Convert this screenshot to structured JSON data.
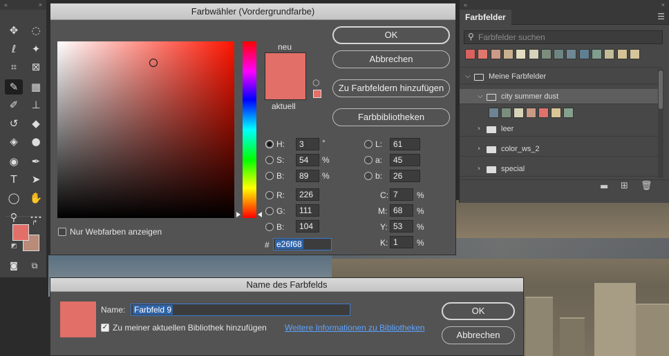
{
  "toolbar": {
    "collapse": "«",
    "close": "×",
    "tools": [
      {
        "name": "move",
        "glyph": "✥"
      },
      {
        "name": "marquee",
        "glyph": "◌"
      },
      {
        "name": "lasso",
        "glyph": "ℓ"
      },
      {
        "name": "magic-wand",
        "glyph": "✦"
      },
      {
        "name": "crop",
        "glyph": "⌗"
      },
      {
        "name": "frame",
        "glyph": "⊠"
      },
      {
        "name": "eyedropper",
        "glyph": "✎"
      },
      {
        "name": "spot-healing",
        "glyph": "▦"
      },
      {
        "name": "brush",
        "glyph": "✐"
      },
      {
        "name": "clone-stamp",
        "glyph": "⊥"
      },
      {
        "name": "history-brush",
        "glyph": "↺"
      },
      {
        "name": "eraser",
        "glyph": "◆"
      },
      {
        "name": "paint-bucket",
        "glyph": "◈"
      },
      {
        "name": "blur",
        "glyph": "●"
      },
      {
        "name": "dodge",
        "glyph": "◉"
      },
      {
        "name": "pen",
        "glyph": "✒"
      },
      {
        "name": "type",
        "glyph": "T"
      },
      {
        "name": "path-select",
        "glyph": "➤"
      },
      {
        "name": "ellipse",
        "glyph": "◯"
      },
      {
        "name": "hand",
        "glyph": "✋"
      },
      {
        "name": "zoom",
        "glyph": "⚲"
      },
      {
        "name": "more",
        "glyph": "•••"
      }
    ],
    "foreground_color": "#e26f68",
    "background_color": "#b98b78"
  },
  "color_picker": {
    "title": "Farbwähler (Vordergrundfarbe)",
    "new_label": "neu",
    "current_label": "aktuell",
    "new_color": "#e26f68",
    "current_color": "#e26f68",
    "buttons": {
      "ok": "OK",
      "cancel": "Abbrechen",
      "add_swatches": "Zu Farbfeldern hinzufügen",
      "libraries": "Farbbibliotheken"
    },
    "web_colors_label": "Nur Webfarben anzeigen",
    "hsb": {
      "h": {
        "label": "H:",
        "value": "3",
        "unit": "°"
      },
      "s": {
        "label": "S:",
        "value": "54",
        "unit": "%"
      },
      "b": {
        "label": "B:",
        "value": "89",
        "unit": "%"
      }
    },
    "rgb": {
      "r": {
        "label": "R:",
        "value": "226"
      },
      "g": {
        "label": "G:",
        "value": "111"
      },
      "b": {
        "label": "B:",
        "value": "104"
      }
    },
    "lab": {
      "l": {
        "label": "L:",
        "value": "61"
      },
      "a": {
        "label": "a:",
        "value": "45"
      },
      "b": {
        "label": "b:",
        "value": "26"
      }
    },
    "cmyk": {
      "c": {
        "label": "C:",
        "value": "7",
        "unit": "%"
      },
      "m": {
        "label": "M:",
        "value": "68",
        "unit": "%"
      },
      "y": {
        "label": "Y:",
        "value": "53",
        "unit": "%"
      },
      "k": {
        "label": "K:",
        "value": "1",
        "unit": "%"
      }
    },
    "hex_label": "#",
    "hex_value": "e26f68"
  },
  "swatches_panel": {
    "collapse": "«",
    "close": "×",
    "tab": "Farbfelder",
    "search_placeholder": "Farbfelder suchen",
    "recent_colors": [
      "#d9625f",
      "#e0776c",
      "#cc9a88",
      "#c9b08e",
      "#e3dcc0",
      "#d6d3bb",
      "#7c8d7c",
      "#6d8583",
      "#6e8894",
      "#5f7f92",
      "#7f9e8d",
      "#c1bd97",
      "#d4c194",
      "#d5c49c"
    ],
    "groups": [
      {
        "name": "Meine Farbfelder",
        "expanded": true
      },
      {
        "name": "city summer dust",
        "expanded": true,
        "colors": [
          "#6d8593",
          "#7b8d7e",
          "#d7d3b9",
          "#c99a86",
          "#e0716c",
          "#d9c596",
          "#85a18e"
        ]
      },
      {
        "name": "leer",
        "expanded": false
      },
      {
        "name": "color_ws_2",
        "expanded": false
      },
      {
        "name": "special",
        "expanded": false
      }
    ]
  },
  "name_dialog": {
    "title": "Name des Farbfelds",
    "color": "#e26f68",
    "name_label": "Name:",
    "name_value": "Farbfeld 9",
    "add_to_library": "Zu meiner aktuellen Bibliothek hinzufügen",
    "more_info_link": "Weitere Informationen zu Bibliotheken",
    "ok": "OK",
    "cancel": "Abbrechen"
  }
}
